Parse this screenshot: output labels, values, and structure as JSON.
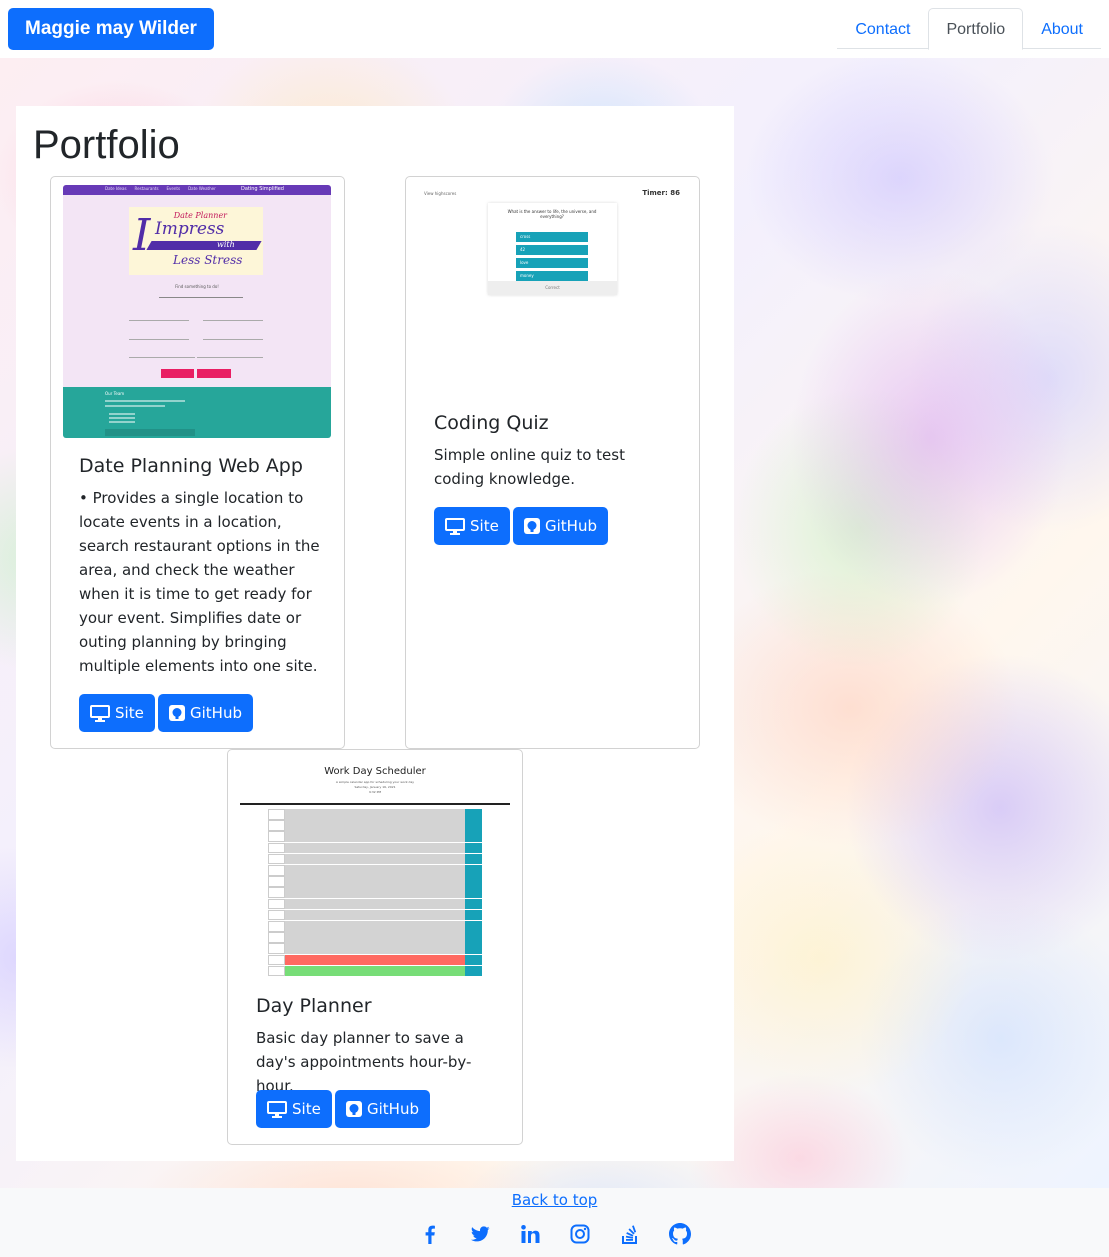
{
  "navbar": {
    "brand": "Maggie may Wilder",
    "tabs": [
      {
        "label": "Contact"
      },
      {
        "label": "Portfolio"
      },
      {
        "label": "About"
      }
    ],
    "active_tab": "Portfolio"
  },
  "main": {
    "title": "Portfolio",
    "projects": [
      {
        "title": "Date Planning Web App",
        "description": "• Provides a single location to locate events in a location, search restaurant options in the area, and check the weather when it is time to get ready for your event. Simplifies date or outing planning by bringing multiple elements into one site.",
        "site_label": "Site",
        "github_label": "GitHub",
        "thumbnail": {
          "nav_links": [
            "Date Ideas",
            "Restaurants",
            "Events",
            "Date Weather"
          ],
          "nav_brand": "Dating Simplified",
          "logo_top": "Date Planner",
          "logo_main": "Impress",
          "logo_with": "with",
          "logo_bottom": "Less Stress",
          "search_heading": "Find something to do!",
          "footer_heading": "Our Team"
        }
      },
      {
        "title": "Coding Quiz",
        "description": "Simple online quiz to test coding knowledge.",
        "site_label": "Site",
        "github_label": "GitHub",
        "thumbnail": {
          "highscores_link": "View highscores",
          "timer": "Timer: 86",
          "question": "What is the answer to life, the universe, and everything?",
          "answers": [
            "cross",
            "42",
            "love",
            "money"
          ],
          "result": "Correct"
        }
      },
      {
        "title": "Day Planner",
        "description": "Basic day planner to save a day's appointments hour-by-hour.",
        "site_label": "Site",
        "github_label": "GitHub",
        "thumbnail": {
          "heading": "Work Day Scheduler",
          "subheading": "A simple calendar app for scheduling your work day",
          "date": "Saturday, January 16, 2021",
          "time": "9:32 PM"
        }
      }
    ]
  },
  "footer": {
    "back_to_top": "Back to top",
    "social_icons": [
      "facebook-icon",
      "twitter-icon",
      "linkedin-icon",
      "instagram-icon",
      "stack-overflow-icon",
      "github-icon"
    ]
  },
  "colors": {
    "primary": "#0d6efd",
    "thumb_purple": "#673ab7",
    "thumb_teal": "#26a69a",
    "quiz_teal": "#17a2b8",
    "planner_past": "#d3d3d3",
    "planner_present": "#ff6961",
    "planner_future": "#77dd77"
  }
}
